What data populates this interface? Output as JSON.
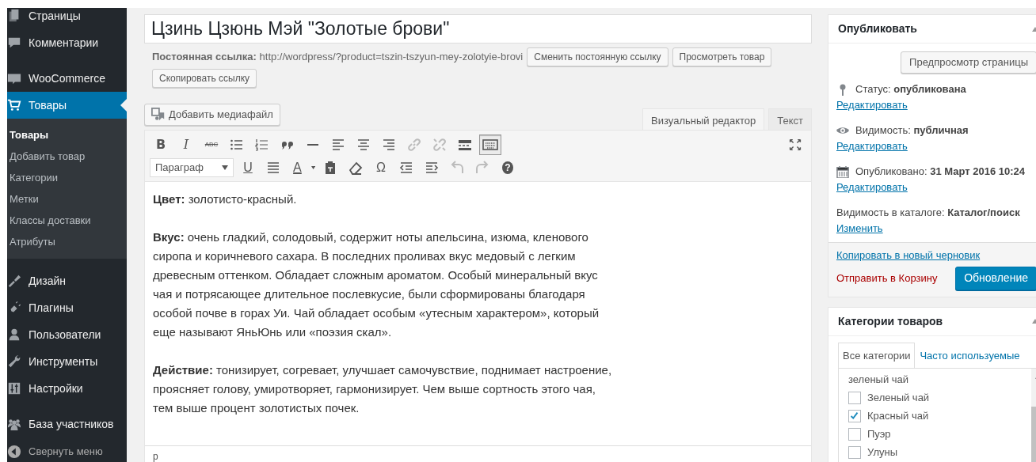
{
  "sidebar": {
    "groups": [
      [
        {
          "label": "Страницы",
          "selected": false
        },
        {
          "label": "Комментарии",
          "selected": false
        }
      ],
      [
        {
          "label": "WooCommerce",
          "selected": false
        },
        {
          "label": "Товары",
          "selected": true,
          "children": [
            {
              "label": "Товары",
              "selected": true
            },
            {
              "label": "Добавить товар",
              "selected": false
            },
            {
              "label": "Категории",
              "selected": false
            },
            {
              "label": "Метки",
              "selected": false
            },
            {
              "label": "Классы доставки",
              "selected": false
            },
            {
              "label": "Атрибуты",
              "selected": false
            }
          ]
        }
      ],
      [
        {
          "label": "Дизайн",
          "selected": false
        },
        {
          "label": "Плагины",
          "selected": false
        },
        {
          "label": "Пользователи",
          "selected": false
        },
        {
          "label": "Инструменты",
          "selected": false
        },
        {
          "label": "Настройки",
          "selected": false
        }
      ],
      [
        {
          "label": "База участников",
          "selected": false
        }
      ]
    ],
    "collapse_label": "Свернуть меню"
  },
  "editor": {
    "title": "Цзинь Цзюнь Мэй \"Золотые брови\"",
    "permalink": "**Постоянная ссылка:** http://wordpress/?product=tszin-tszyun-mey-zolotyie-brovi",
    "permalink_buttons": [
      "Сменить постоянную ссылку",
      "Просмотреть товар",
      "Скопировать ссылку"
    ],
    "media_button": "Добавить медиафайл",
    "tabs": [
      {
        "label": "Визуальный редактор",
        "selected": true
      },
      {
        "label": "Текст",
        "selected": false
      }
    ],
    "toolbar_rows": [
      [
        {
          "glyph": "B",
          "disabled": false,
          "pressed": false
        },
        {
          "glyph": "I",
          "disabled": false,
          "pressed": false
        },
        {
          "glyph": "ABC",
          "disabled": false,
          "pressed": false
        },
        {
          "disabled": false,
          "pressed": false
        },
        {
          "disabled": false,
          "pressed": false
        },
        {
          "disabled": false,
          "pressed": false
        },
        {
          "disabled": false,
          "pressed": false
        },
        {
          "disabled": false,
          "pressed": false
        },
        {
          "disabled": false,
          "pressed": false
        },
        {
          "disabled": false,
          "pressed": false
        },
        {
          "disabled": true,
          "pressed": false
        },
        {
          "disabled": true,
          "pressed": false
        },
        {
          "disabled": false,
          "pressed": false
        },
        {
          "disabled": false,
          "pressed": true
        }
      ],
      [
        {
          "glyph": "U",
          "disabled": false,
          "pressed": false
        },
        {
          "disabled": false,
          "pressed": false
        },
        {
          "glyph": "A",
          "disabled": false,
          "pressed": false
        },
        {
          "disabled": false,
          "pressed": false
        },
        {
          "disabled": false,
          "pressed": false
        },
        {
          "glyph": "Ω",
          "disabled": false,
          "pressed": false
        },
        {
          "disabled": false,
          "pressed": false
        },
        {
          "disabled": false,
          "pressed": false
        },
        {
          "disabled": true,
          "pressed": false
        },
        {
          "disabled": true,
          "pressed": false
        },
        {
          "glyph": "?",
          "disabled": false,
          "pressed": false
        }
      ]
    ],
    "format_select": "Параграф",
    "paragraphs": [
      "**Цвет:** золотисто-красный.",
      "**Вкус:** очень гладкий, солодовый, содержит ноты апельсина, изюма, кленового сиропа и коричневого сахара. В последних проливах вкус медовый с легким древесным оттенком. Обладает сложным ароматом. Особый минеральный вкус чая и потрясающее длительное послевкусие, были сформированы благодаря особой почве в горах Уи. Чай обладает особым «утесным характером», который еще называют ЯньЮнь или «поэзия скал».",
      "**Действие:** тонизирует, согревает, улучшает самочувствие, поднимает настроение, проясняет голову, умиротворяет, гармонизирует. Чем выше сортность этого чая, тем выше процент золотистых почек."
    ],
    "path": "p"
  },
  "publish": {
    "title": "Опубликовать",
    "preview_button": "Предпросмотр страницы",
    "rows": [
      {
        "text": "Статус: **опубликована**",
        "link": "Редактировать"
      },
      {
        "text": "Видимость: **публичная**",
        "link": "Редактировать"
      },
      {
        "text": "Опубликовано: **31 Март 2016 10:24**",
        "link": "Редактировать"
      },
      {
        "text": "Видимость в каталоге: **Каталог/поиск**",
        "link": "Изменить"
      }
    ],
    "copy_link": "Копировать в новый черновик",
    "trash_link": "Отправить в Корзину",
    "update_button": "Обновление"
  },
  "categories": {
    "title": "Категории товаров",
    "tabs": [
      {
        "label": "Все категории",
        "selected": true
      },
      {
        "label": "Часто используемые",
        "selected": false
      }
    ],
    "items": [
      {
        "kind": "text",
        "label": "зеленый чай"
      },
      {
        "kind": "checkbox",
        "label": "Зеленый чай",
        "checked": false
      },
      {
        "kind": "checkbox",
        "label": "Красный чай",
        "checked": true
      },
      {
        "kind": "checkbox",
        "label": "Пуэр",
        "checked": false
      },
      {
        "kind": "checkbox",
        "label": "Улуны",
        "checked": false
      }
    ]
  }
}
